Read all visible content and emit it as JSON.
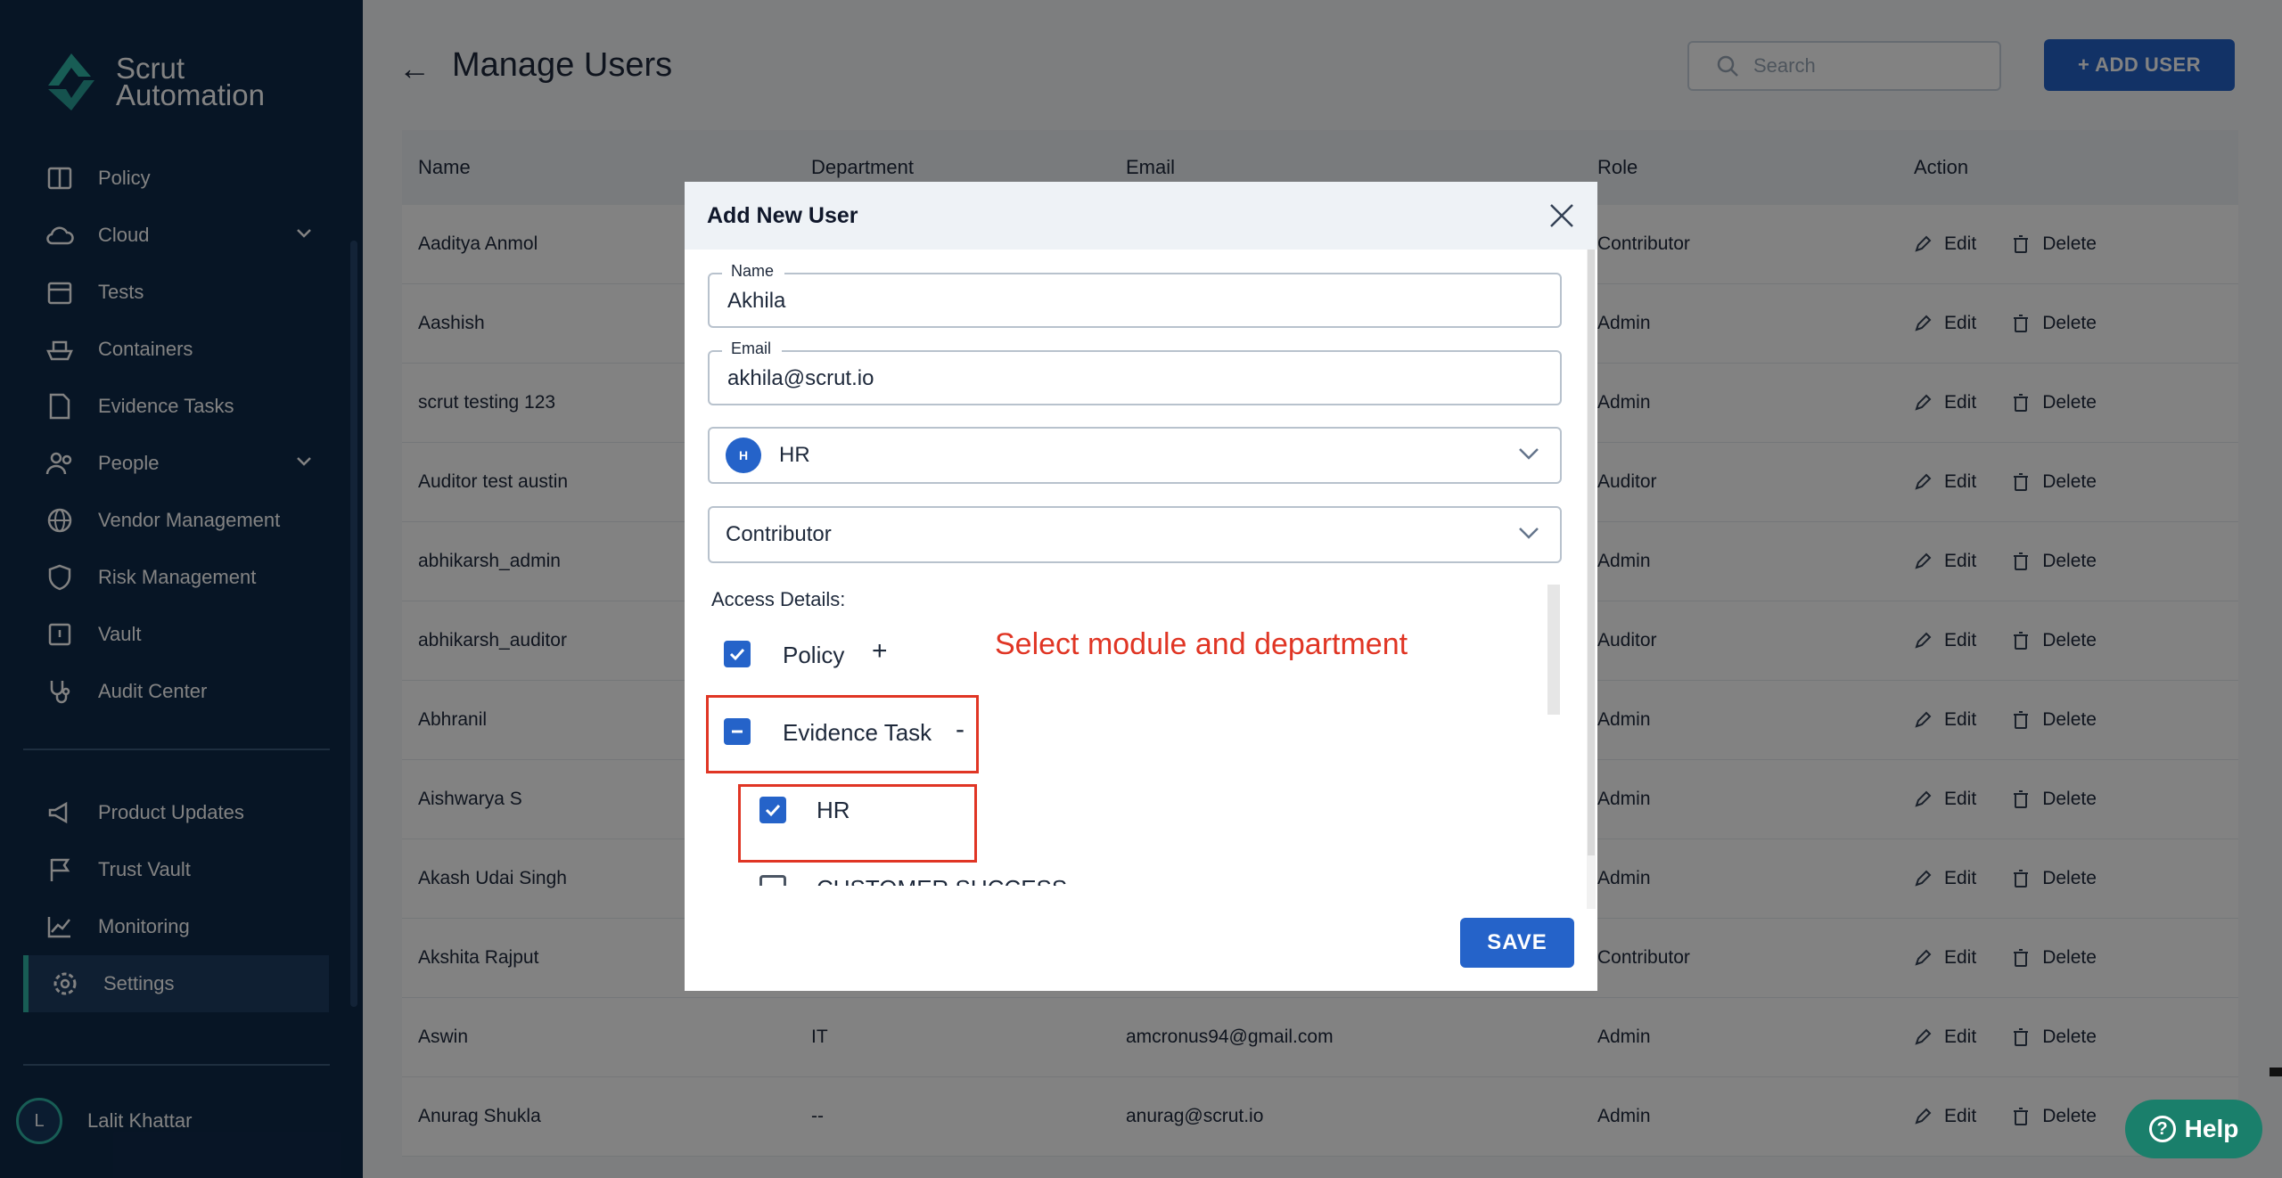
{
  "brand": {
    "line1": "Scrut",
    "line2": "Automation"
  },
  "sidebar": {
    "items": [
      {
        "label": "Policy",
        "icon": "book-icon"
      },
      {
        "label": "Cloud",
        "icon": "cloud-icon",
        "expandable": true
      },
      {
        "label": "Tests",
        "icon": "calendar-icon"
      },
      {
        "label": "Containers",
        "icon": "ship-icon"
      },
      {
        "label": "Evidence Tasks",
        "icon": "document-icon"
      },
      {
        "label": "People",
        "icon": "people-icon",
        "expandable": true
      },
      {
        "label": "Vendor Management",
        "icon": "globe-icon"
      },
      {
        "label": "Risk Management",
        "icon": "shield-icon"
      },
      {
        "label": "Vault",
        "icon": "vault-icon"
      },
      {
        "label": "Audit Center",
        "icon": "stethoscope-icon"
      }
    ],
    "bottom_items": [
      {
        "label": "Product Updates",
        "icon": "megaphone-icon"
      },
      {
        "label": "Trust Vault",
        "icon": "flag-icon"
      },
      {
        "label": "Monitoring",
        "icon": "chart-icon"
      },
      {
        "label": "Settings",
        "icon": "gear-icon",
        "active": true
      }
    ],
    "user": {
      "initial": "L",
      "name": "Lalit Khattar"
    }
  },
  "header": {
    "title": "Manage Users",
    "search_placeholder": "Search",
    "add_user_label": "+ ADD USER"
  },
  "table": {
    "columns": [
      "Name",
      "Department",
      "Email",
      "Role",
      "Action"
    ],
    "edit_label": "Edit",
    "delete_label": "Delete",
    "rows": [
      {
        "name": "Aaditya Anmol",
        "department": "",
        "email": "",
        "role": "Contributor"
      },
      {
        "name": "Aashish",
        "department": "",
        "email": "",
        "role": "Admin"
      },
      {
        "name": "scrut testing 123",
        "department": "",
        "email": "",
        "role": "Admin"
      },
      {
        "name": "Auditor test austin",
        "department": "",
        "email": "",
        "role": "Auditor"
      },
      {
        "name": "abhikarsh_admin",
        "department": "",
        "email": "",
        "role": "Admin"
      },
      {
        "name": "abhikarsh_auditor",
        "department": "",
        "email": "",
        "role": "Auditor"
      },
      {
        "name": "Abhranil",
        "department": "",
        "email": "",
        "role": "Admin"
      },
      {
        "name": "Aishwarya S",
        "department": "",
        "email": "",
        "role": "Admin"
      },
      {
        "name": "Akash Udai Singh",
        "department": "",
        "email": "",
        "role": "Admin"
      },
      {
        "name": "Akshita Rajput",
        "department": "",
        "email": "",
        "role": "Contributor"
      },
      {
        "name": "Aswin",
        "department": "IT",
        "email": "amcronus94@gmail.com",
        "role": "Admin"
      },
      {
        "name": "Anurag Shukla",
        "department": "--",
        "email": "anurag@scrut.io",
        "role": "Admin"
      }
    ]
  },
  "modal": {
    "title": "Add New User",
    "name_label": "Name",
    "name_value": "Akhila",
    "email_label": "Email",
    "email_value": "akhila@scrut.io",
    "department": {
      "badge": "H",
      "value": "HR"
    },
    "role_value": "Contributor",
    "access_label": "Access Details:",
    "modules": [
      {
        "label": "Policy",
        "state": "checked",
        "toggle": "+"
      },
      {
        "label": "Evidence Task",
        "state": "indeterminate",
        "toggle": "-"
      }
    ],
    "sub_departments": [
      {
        "label": "HR",
        "state": "checked"
      },
      {
        "label": "CUSTOMER SUCCESS",
        "state": "unchecked"
      }
    ],
    "save_label": "SAVE"
  },
  "annotation": {
    "text": "Select module and department",
    "color": "#e03524"
  },
  "help": {
    "label": "Help"
  },
  "colors": {
    "primary": "#2563c9",
    "sidebar": "#0f2a4a",
    "accent": "#2fb7a8",
    "help": "#1a7f6b"
  }
}
